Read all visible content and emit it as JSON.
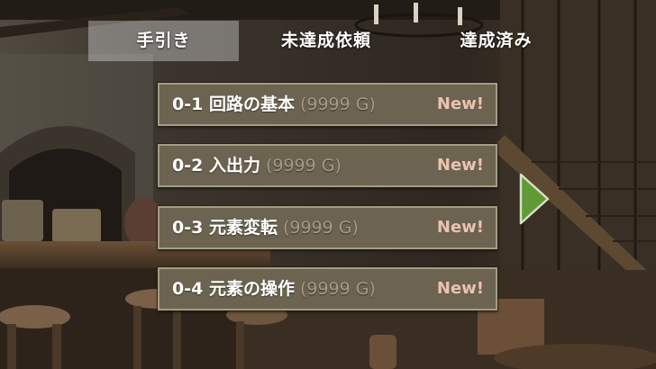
{
  "tabs": [
    {
      "label": "手引き",
      "active": true
    },
    {
      "label": "未達成依頼",
      "active": false
    },
    {
      "label": "達成済み",
      "active": false
    }
  ],
  "quests": [
    {
      "title": "0-1 回路の基本",
      "reward": "(9999 G)",
      "badge": "New!"
    },
    {
      "title": "0-2 入出力",
      "reward": "(9999 G)",
      "badge": "New!"
    },
    {
      "title": "0-3 元素変転",
      "reward": "(9999 G)",
      "badge": "New!"
    },
    {
      "title": "0-4 元素の操作",
      "reward": "(9999 G)",
      "badge": "New!"
    }
  ],
  "next_arrow": {
    "icon": "play-arrow-icon",
    "color": "#5f9a36"
  },
  "colors": {
    "quest_bg": "#6c6350",
    "quest_border": "#a59c85",
    "new_badge": "#ecc2b1",
    "reward_text": "#a39b86"
  }
}
